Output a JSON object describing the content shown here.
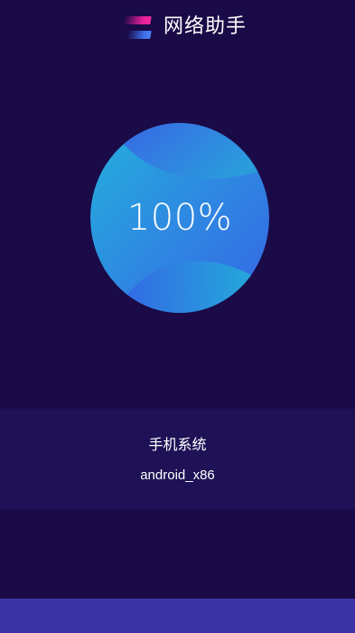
{
  "app": {
    "title": "网络助手",
    "logo_icon": "stacked-bars-logo-icon"
  },
  "progress": {
    "value_text": "100%",
    "fraction": 1.0
  },
  "info": {
    "label": "手机系统",
    "value": "android_x86"
  },
  "colors": {
    "background": "#1a0a47",
    "panel": "#1f1156",
    "bottom_bar": "#3a34a6",
    "orb_light": "#27a7dc",
    "orb_dark": "#3566e6",
    "logo_pink": "#e61f9b",
    "logo_blue": "#3c6ee8"
  }
}
